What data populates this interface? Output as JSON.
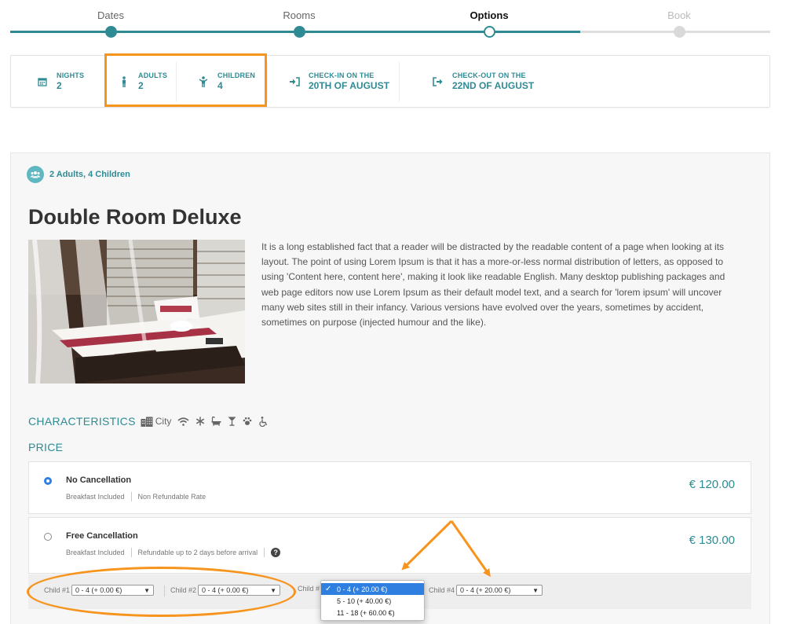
{
  "stepper": {
    "steps": [
      {
        "label": "Dates",
        "state": "done"
      },
      {
        "label": "Rooms",
        "state": "done"
      },
      {
        "label": "Options",
        "state": "current"
      },
      {
        "label": "Book",
        "state": "future"
      }
    ]
  },
  "summary": {
    "nights": {
      "label": "NIGHTS",
      "value": "2"
    },
    "adults": {
      "label": "ADULTS",
      "value": "2"
    },
    "children": {
      "label": "CHILDREN",
      "value": "4"
    },
    "checkin": {
      "label": "CHECK-IN ON THE",
      "value": "20TH OF AUGUST"
    },
    "checkout": {
      "label": "CHECK-OUT ON THE",
      "value": "22ND OF AUGUST"
    }
  },
  "room": {
    "occupancy": "2 Adults, 4 Children",
    "title": "Double Room Deluxe",
    "description": "It is a long established fact that a reader will be distracted by the readable content of a page when looking at its layout. The point of using Lorem Ipsum is that it has a more-or-less normal distribution of letters, as opposed to using 'Content here, content here', making it look like readable English. Many desktop publishing packages and web page editors now use Lorem Ipsum as their default model text, and a search for 'lorem ipsum' will uncover many web sites still in their infancy. Various versions have evolved over the years, sometimes by accident, sometimes on purpose (injected humour and the like).",
    "characteristics_label": "CHARACTERISTICS",
    "city_label": "City",
    "characteristic_icons": [
      "wifi-icon",
      "snowflake-icon",
      "bathtub-icon",
      "cocktail-icon",
      "paw-icon",
      "wheelchair-icon"
    ],
    "price_label": "PRICE"
  },
  "rates": [
    {
      "name": "No Cancellation",
      "meta": [
        "Breakfast Included",
        "Non Refundable Rate"
      ],
      "price": "€ 120.00",
      "selected": true
    },
    {
      "name": "Free Cancellation",
      "meta": [
        "Breakfast Included",
        "Refundable up to 2 days before arrival"
      ],
      "price": "€ 130.00",
      "selected": false
    }
  ],
  "children_ages": {
    "child1": {
      "label": "Child #1",
      "value": "0 - 4 (+ 0.00 €)"
    },
    "child2": {
      "label": "Child #2",
      "value": "0 - 4 (+ 0.00 €)"
    },
    "child3": {
      "label": "Child #"
    },
    "child4": {
      "label": "Child #4",
      "value": "0 - 4 (+ 20.00 €)"
    }
  },
  "age_dropdown": {
    "options": [
      "0 - 4 (+ 20.00 €)",
      "5 - 10 (+ 40.00 €)",
      "11 - 18 (+ 60.00 €)"
    ],
    "selected_index": 0
  },
  "colors": {
    "accent": "#2e8b94",
    "highlight": "#f7941d",
    "select_blue": "#2f7fe0"
  }
}
